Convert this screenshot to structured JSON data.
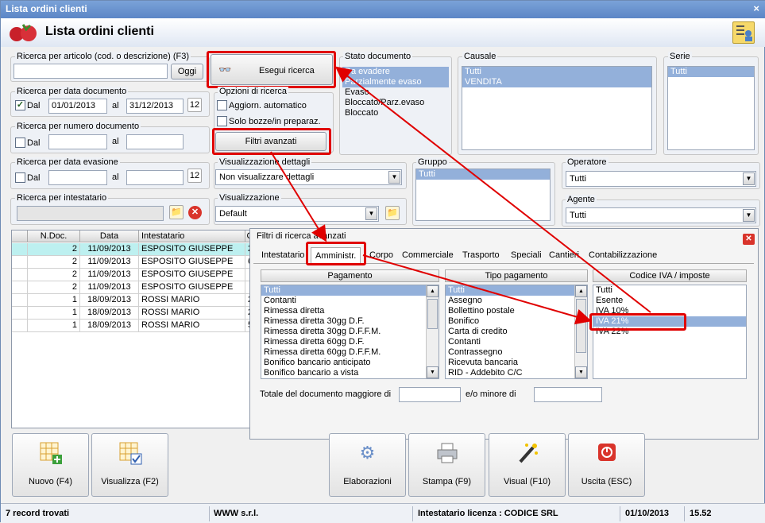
{
  "window": {
    "title": "Lista ordini clienti",
    "close": "×"
  },
  "header": {
    "title": "Lista ordini clienti"
  },
  "ricerca_articolo": {
    "label": "Ricerca per articolo (cod. o descrizione) (F3)",
    "value": "",
    "button": "Oggi"
  },
  "esegui": {
    "label": "Esegui ricerca"
  },
  "data_documento": {
    "label": "Ricerca per data documento",
    "dal_label": "Dal",
    "dal": "01/01/2013",
    "al_label": "al",
    "al": "31/12/2013",
    "checked": true
  },
  "numero_documento": {
    "label": "Ricerca per numero documento",
    "dal_label": "Dal",
    "al_label": "al"
  },
  "data_evasione": {
    "label": "Ricerca per data evasione",
    "dal_label": "Dal",
    "al_label": "al"
  },
  "intestatario": {
    "label": "Ricerca per intestatario"
  },
  "opzioni": {
    "label": "Opzioni di ricerca",
    "aggiorn": "Aggiorn. automatico",
    "solo_bozze": "Solo bozze/in preparaz.",
    "filtri": "Filtri avanzati"
  },
  "stato": {
    "label": "Stato documento",
    "items": [
      "Da evadere",
      "Parzialmente evaso",
      "Evaso",
      "Bloccato/Parz.evaso",
      "Bloccato"
    ]
  },
  "causale": {
    "label": "Causale",
    "items": [
      "Tutti",
      "VENDITA"
    ]
  },
  "serie": {
    "label": "Serie",
    "items": [
      "Tutti"
    ]
  },
  "visualizzazione_dettagli": {
    "label": "Visualizzazione dettagli",
    "value": "Non visualizzare dettagli"
  },
  "visualizzazione": {
    "label": "Visualizzazione",
    "value": "Default"
  },
  "gruppo": {
    "label": "Gruppo",
    "items": [
      "Tutti"
    ]
  },
  "operatore": {
    "label": "Operatore",
    "value": "Tutti"
  },
  "agente": {
    "label": "Agente",
    "value": "Tutti"
  },
  "grid": {
    "columns": [
      "N.Doc.",
      "Data",
      "Intestatario",
      "C"
    ],
    "rows": [
      [
        "2",
        "11/09/2013",
        "ESPOSITO GIUSEPPE",
        "2"
      ],
      [
        "2",
        "11/09/2013",
        "ESPOSITO GIUSEPPE",
        "6"
      ],
      [
        "2",
        "11/09/2013",
        "ESPOSITO GIUSEPPE",
        ""
      ],
      [
        "2",
        "11/09/2013",
        "ESPOSITO GIUSEPPE",
        ""
      ],
      [
        "1",
        "18/09/2013",
        "ROSSI MARIO",
        "2"
      ],
      [
        "1",
        "18/09/2013",
        "ROSSI MARIO",
        "2"
      ],
      [
        "1",
        "18/09/2013",
        "ROSSI MARIO",
        "5"
      ]
    ]
  },
  "filtri_panel": {
    "title": "Filtri di ricerca avanzati",
    "tabs": [
      "Intestatario",
      "Amministr.",
      "Corpo",
      "Commerciale",
      "Trasporto",
      "Speciali",
      "Cantieri",
      "Contabilizzazione"
    ],
    "pagamento": {
      "header": "Pagamento",
      "items": [
        "Tutti",
        "Contanti",
        "Rimessa diretta",
        "Rimessa diretta 30gg D.F.",
        "Rimessa diretta 30gg D.F.F.M.",
        "Rimessa diretta 60gg D.F.",
        "Rimessa diretta 60gg D.F.F.M.",
        "Bonifico bancario anticipato",
        "Bonifico bancario a vista"
      ]
    },
    "tipo_pagamento": {
      "header": "Tipo pagamento",
      "items": [
        "Tutti",
        "Assegno",
        "Bollettino postale",
        "Bonifico",
        "Carta di credito",
        "Contanti",
        "Contrassegno",
        "Ricevuta bancaria",
        "RID - Addebito C/C"
      ]
    },
    "iva": {
      "header": "Codice IVA / imposte",
      "items": [
        "Tutti",
        "Esente",
        "IVA 10%",
        "IVA 21%",
        "IVA 22%"
      ]
    },
    "totale_maggiore": "Totale del documento maggiore di",
    "minore": "e/o minore di"
  },
  "buttons": [
    "Nuovo (F4)",
    "Visualizza (F2)",
    "Elaborazioni",
    "Stampa (F9)",
    "Visual (F10)",
    "Uscita (ESC)"
  ],
  "status": {
    "records": "7 record trovati",
    "company": "WWW s.r.l.",
    "licenza": "Intestatario licenza : CODICE SRL",
    "date": "01/10/2013",
    "time": "15.52"
  }
}
